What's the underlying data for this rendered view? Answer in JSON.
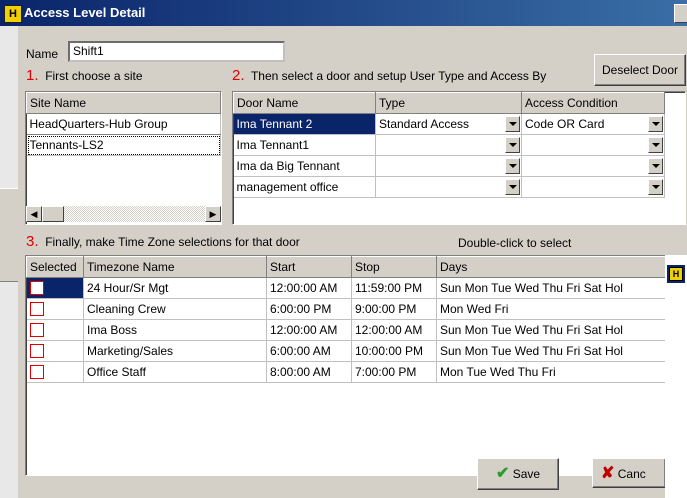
{
  "window": {
    "title": "Access Level Detail",
    "icon": "app-shield-icon"
  },
  "name_field": {
    "label": "Name",
    "value": "Shift1"
  },
  "deselect_button": "Deselect Door",
  "step1": {
    "num": "1.",
    "text": "First choose a site"
  },
  "step2": {
    "num": "2.",
    "text": "Then select a door and setup User Type and Access By"
  },
  "step3": {
    "num": "3.",
    "text": "Finally, make Time Zone selections for that door"
  },
  "double_click_hint": "Double-click to select",
  "sites": {
    "header": "Site Name",
    "items": [
      "HeadQuarters-Hub Group",
      "Tennants-LS2"
    ]
  },
  "doors": {
    "headers": [
      "Door Name",
      "Type",
      "Access Condition"
    ],
    "rows": [
      {
        "name": "Ima Tennant 2",
        "type": "Standard Access",
        "access": "Code OR Card",
        "selected": true
      },
      {
        "name": "Ima Tennant1",
        "type": "",
        "access": "",
        "selected": false
      },
      {
        "name": "Ima da Big Tennant",
        "type": "",
        "access": "",
        "selected": false
      },
      {
        "name": "management office",
        "type": "",
        "access": "",
        "selected": false
      }
    ]
  },
  "timezones": {
    "headers": [
      "Selected",
      "Timezone Name",
      "Start",
      "Stop",
      "Days"
    ],
    "rows": [
      {
        "name": "24 Hour/Sr Mgt",
        "start": "12:00:00 AM",
        "stop": "11:59:00 PM",
        "days": "Sun Mon Tue Wed Thu Fri Sat Hol",
        "checked": false
      },
      {
        "name": "Cleaning Crew",
        "start": "6:00:00 PM",
        "stop": "9:00:00 PM",
        "days": "Mon Wed Fri",
        "checked": false
      },
      {
        "name": "Ima Boss",
        "start": "12:00:00 AM",
        "stop": "12:00:00 AM",
        "days": "Sun Mon Tue Wed Thu Fri Sat Hol",
        "checked": false
      },
      {
        "name": "Marketing/Sales",
        "start": "6:00:00 AM",
        "stop": "10:00:00 PM",
        "days": "Sun Mon Tue Wed Thu Fri Sat Hol",
        "checked": false
      },
      {
        "name": "Office Staff",
        "start": "8:00:00 AM",
        "stop": "7:00:00 PM",
        "days": "Mon Tue Wed Thu Fri",
        "checked": false
      }
    ]
  },
  "save_button": "Save",
  "cancel_button": "Canc",
  "colors": {
    "title_bar": "#0a246a",
    "selection": "#0a246a",
    "step_number": "#e00000",
    "save_check": "#2a9d2a",
    "cancel_x": "#c00000"
  }
}
